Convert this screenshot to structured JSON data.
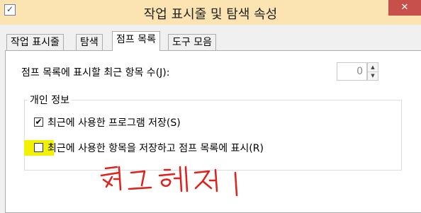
{
  "window": {
    "title": "작업 표시줄 및 탐색 속성",
    "close_glyph": "✕",
    "app_icon_glyph": "✓"
  },
  "tabs": [
    {
      "label": "작업 표시줄",
      "active": false
    },
    {
      "label": "탐색",
      "active": false
    },
    {
      "label": "점프 목록",
      "active": true
    },
    {
      "label": "도구 모음",
      "active": false
    }
  ],
  "jump_list": {
    "count_label": "점프 목록에 표시할 최근 항목 수(J):",
    "count_value": "0"
  },
  "privacy": {
    "group_title": "개인 정보",
    "options": [
      {
        "label": "최근에 사용한 프로그램 저장(S)",
        "checked": true,
        "glyph": "✔"
      },
      {
        "label": "최근에 사용한 항목을 저장하고 점프 목록에 표시(R)",
        "checked": false,
        "glyph": ""
      }
    ]
  },
  "annotation": {
    "highlight_color": "#f2f200",
    "ink_color": "#e0201a"
  }
}
